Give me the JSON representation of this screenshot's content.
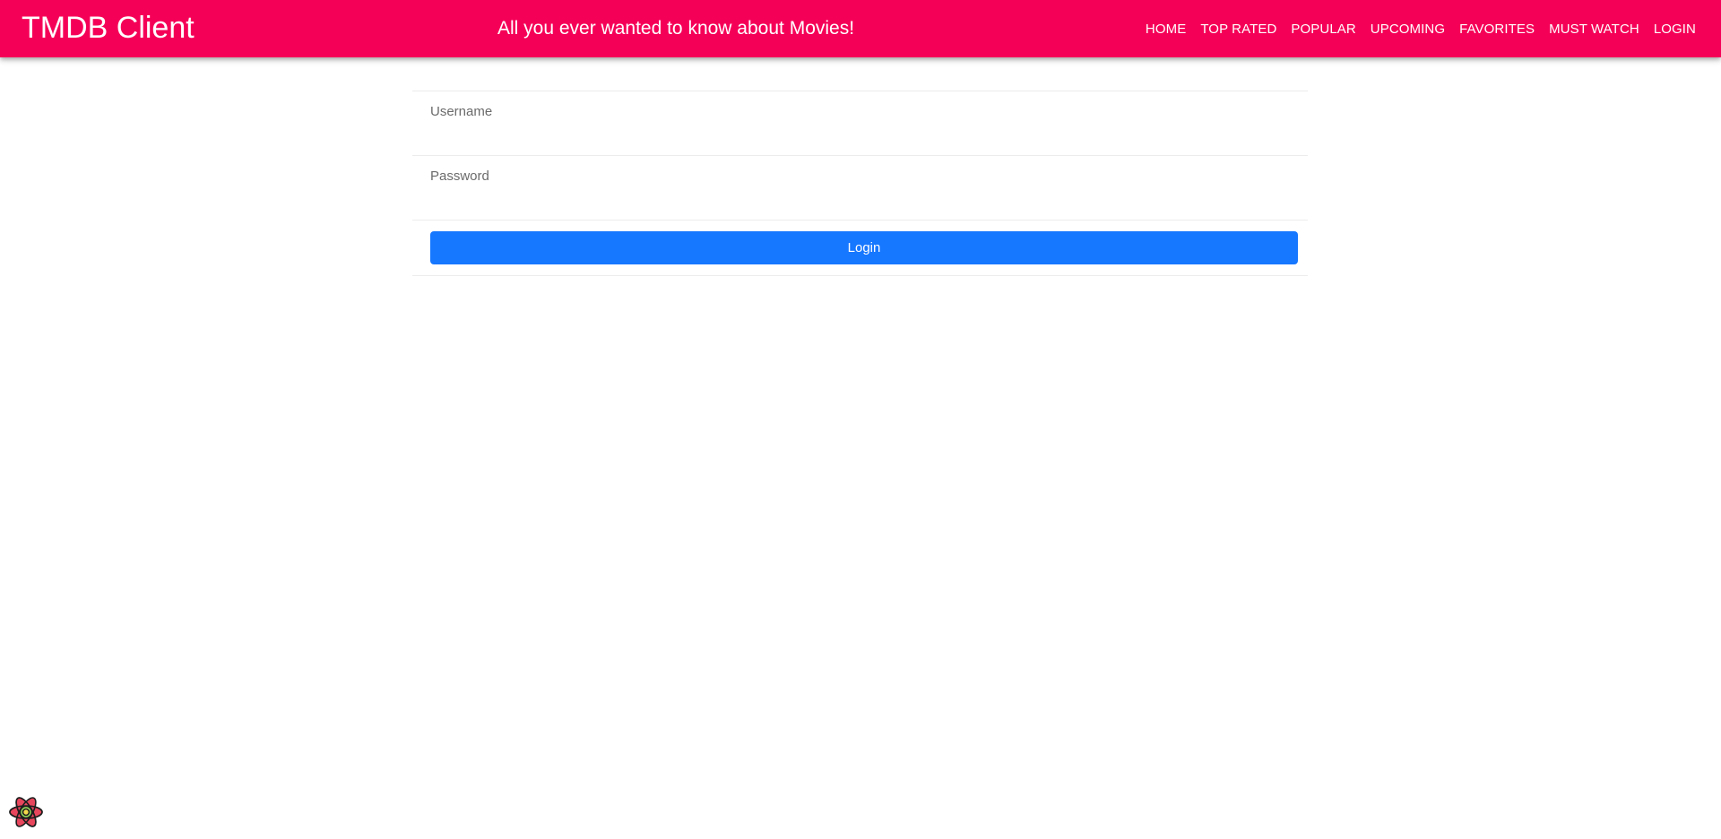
{
  "header": {
    "title": "TMDB Client",
    "tagline": "All you ever wanted to know about Movies!",
    "nav": [
      {
        "label": "HOME"
      },
      {
        "label": "TOP RATED"
      },
      {
        "label": "POPULAR"
      },
      {
        "label": "UPCOMING"
      },
      {
        "label": "FAVORITES"
      },
      {
        "label": "MUST WATCH"
      },
      {
        "label": "LOGIN"
      }
    ]
  },
  "form": {
    "username_label": "Username",
    "username_value": "",
    "password_label": "Password",
    "password_value": "",
    "login_label": "Login"
  },
  "colors": {
    "appbar": "#f50057",
    "button": "#1677ff"
  },
  "icons": {
    "corner": "react-logo-icon"
  }
}
